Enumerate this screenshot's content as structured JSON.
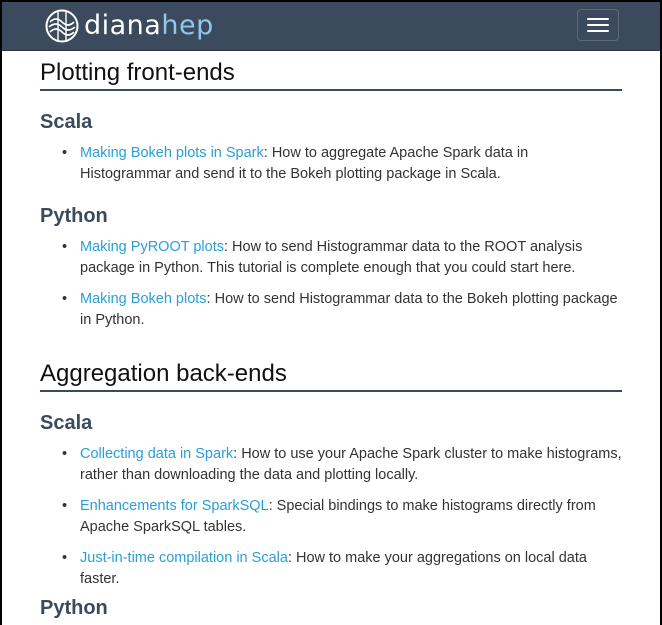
{
  "brand": {
    "part1": "diana",
    "part2": "hep"
  },
  "nav": {
    "toggle_icon": "hamburger-menu-icon"
  },
  "sections": [
    {
      "title": "Plotting front-ends",
      "groups": [
        {
          "heading": "Scala",
          "items": [
            {
              "link": "Making Bokeh plots in Spark",
              "text": ": How to aggregate Apache Spark data in Histogrammar and send it to the Bokeh plotting package in Scala."
            }
          ]
        },
        {
          "heading": "Python",
          "items": [
            {
              "link": "Making PyROOT plots",
              "text": ": How to send Histogrammar data to the ROOT analysis package in Python. This tutorial is complete enough that you could start here."
            },
            {
              "link": "Making Bokeh plots",
              "text": ": How to send Histogrammar data to the Bokeh plotting package in Python."
            }
          ]
        }
      ]
    },
    {
      "title": "Aggregation back-ends",
      "groups": [
        {
          "heading": "Scala",
          "items": [
            {
              "link": "Collecting data in Spark",
              "text": ": How to use your Apache Spark cluster to make histograms, rather than downloading the data and plotting locally."
            },
            {
              "link": "Enhancements for SparkSQL",
              "text": ": Special bindings to make histograms directly from Apache SparkSQL tables."
            },
            {
              "link": "Just-in-time compilation in Scala",
              "text": ": How to make your aggregations on local data faster."
            }
          ]
        },
        {
          "heading": "Python",
          "items": []
        }
      ]
    }
  ]
}
